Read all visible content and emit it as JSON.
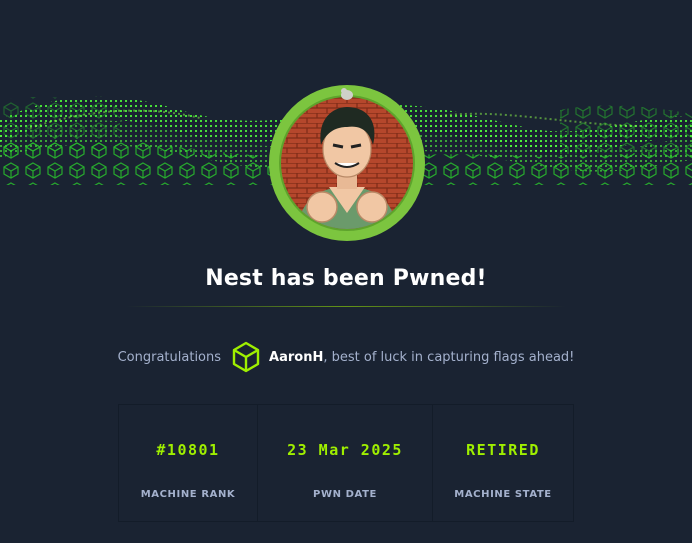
{
  "header": {
    "title": "Nest has been Pwned!"
  },
  "congrats": {
    "prefix": "Congratulations",
    "username": "AaronH",
    "suffix": ", best of luck in capturing flags ahead!"
  },
  "stats": [
    {
      "value": "#10801",
      "label": "MACHINE RANK"
    },
    {
      "value": "23 Mar 2025",
      "label": "PWN DATE"
    },
    {
      "value": "RETIRED",
      "label": "MACHINE STATE"
    }
  ],
  "colors": {
    "background": "#1a2332",
    "accent": "#9fef00",
    "muted_text": "#a4b1cd",
    "avatar_ring": "#7cc53f"
  },
  "icons": {
    "avatar": "machine-avatar-icon",
    "cube": "hackthebox-cube-icon"
  }
}
